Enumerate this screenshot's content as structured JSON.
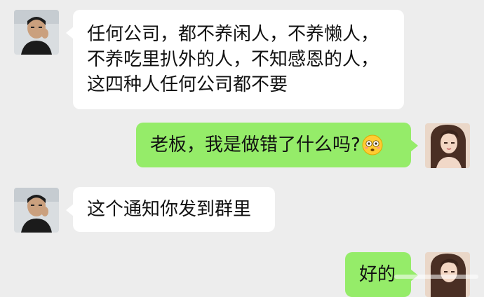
{
  "conversation": [
    {
      "sender": "boss",
      "side": "left",
      "lines": [
        "任何公司，都不养闲人，不养懒人，",
        "不养吃里扒外的人，不知感恩的人，",
        "这四种人任何公司都不要"
      ]
    },
    {
      "sender": "me",
      "side": "right",
      "text": "老板，我是做错了什么吗?",
      "emoji": "flushed-face-icon"
    },
    {
      "sender": "boss",
      "side": "left",
      "text": "这个通知你发到群里"
    },
    {
      "sender": "me",
      "side": "right",
      "text": "好的"
    }
  ],
  "colors": {
    "background": "#ededed",
    "incoming_bubble": "#ffffff",
    "outgoing_bubble": "#95ec69",
    "text": "#111111"
  }
}
